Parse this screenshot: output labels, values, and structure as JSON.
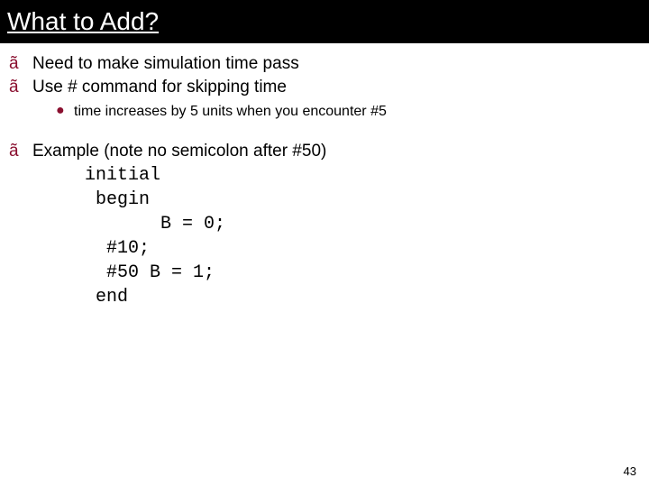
{
  "title": "What to Add?",
  "bullets": {
    "marker": "ã",
    "items": [
      {
        "text": "Need to make simulation time pass"
      },
      {
        "text": "Use # command for skipping time"
      }
    ],
    "sub": {
      "marker": "●",
      "text": "time increases by 5 units when you encounter #5"
    },
    "example_label": "Example (note no semicolon after #50)"
  },
  "code": {
    "l1": "initial",
    "l2": " begin",
    "l3": "       B = 0;",
    "l4": "  #10;",
    "l5": "  #50 B = 1;",
    "l6": " end"
  },
  "page_number": "43"
}
